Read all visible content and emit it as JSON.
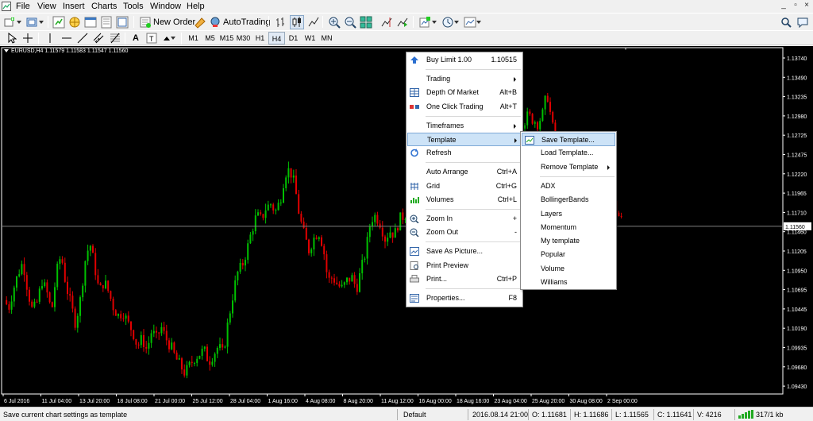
{
  "menu": [
    "File",
    "View",
    "Insert",
    "Charts",
    "Tools",
    "Window",
    "Help"
  ],
  "toolbar": {
    "new_order_label": "New Order",
    "autotrading_label": "AutoTrading",
    "timeframes": [
      "M1",
      "M5",
      "M15",
      "M30",
      "H1",
      "H4",
      "D1",
      "W1",
      "MN"
    ],
    "active_timeframe": "H4"
  },
  "chart": {
    "title": "EURUSD,H4  1.11579 1.11583 1.11547 1.11560",
    "current_price_label": "1.11560",
    "colors": {
      "background": "#000000",
      "bull": "#00c000",
      "bear": "#e00000",
      "axis_text": "#ffffff",
      "price_line": "#808080"
    }
  },
  "chart_data": {
    "type": "candlestick",
    "symbol": "EURUSD",
    "timeframe": "H4",
    "y_ticks": [
      "1.13740",
      "1.13490",
      "1.13235",
      "1.12980",
      "1.12725",
      "1.12475",
      "1.12220",
      "1.11965",
      "1.11710",
      "1.11460",
      "1.11205",
      "1.10950",
      "1.10695",
      "1.10445",
      "1.10190",
      "1.09935",
      "1.09680",
      "1.09430"
    ],
    "x_ticks": [
      "6 Jul 2016",
      "11 Jul 04:00",
      "13 Jul 20:00",
      "18 Jul 08:00",
      "21 Jul 00:00",
      "25 Jul 12:00",
      "28 Jul 04:00",
      "1 Aug 16:00",
      "4 Aug 08:00",
      "8 Aug 20:00",
      "11 Aug 12:00",
      "16 Aug 00:00",
      "18 Aug 16:00",
      "23 Aug 04:00",
      "25 Aug 20:00",
      "30 Aug 08:00",
      "2 Sep 00:00"
    ],
    "ylim": [
      1.0938,
      1.1384
    ],
    "current_price": 1.1156,
    "close_path": [
      [
        0,
        1.106
      ],
      [
        6,
        1.105
      ],
      [
        12,
        1.1075
      ],
      [
        18,
        1.1095
      ],
      [
        24,
        1.111
      ],
      [
        30,
        1.1072
      ],
      [
        36,
        1.1045
      ],
      [
        42,
        1.1058
      ],
      [
        48,
        1.1085
      ],
      [
        54,
        1.107
      ],
      [
        60,
        1.1045
      ],
      [
        66,
        1.1095
      ],
      [
        72,
        1.112
      ],
      [
        78,
        1.108
      ],
      [
        84,
        1.1055
      ],
      [
        90,
        1.103
      ],
      [
        96,
        1.106
      ],
      [
        102,
        1.111
      ],
      [
        108,
        1.1135
      ],
      [
        114,
        1.1105
      ],
      [
        120,
        1.107
      ],
      [
        126,
        1.1085
      ],
      [
        132,
        1.107
      ],
      [
        138,
        1.105
      ],
      [
        144,
        1.104
      ],
      [
        150,
        1.1045
      ],
      [
        156,
        1.103
      ],
      [
        162,
        1.102
      ],
      [
        168,
        1.1
      ],
      [
        174,
        1.101
      ],
      [
        180,
        1.0995
      ],
      [
        186,
        1.102
      ],
      [
        192,
        1.101
      ],
      [
        198,
        1.1025
      ],
      [
        204,
        1.101
      ],
      [
        210,
        1.1
      ],
      [
        216,
        1.0985
      ],
      [
        222,
        1.0975
      ],
      [
        228,
        1.0965
      ],
      [
        234,
        1.0975
      ],
      [
        240,
        1.0985
      ],
      [
        246,
        1.099
      ],
      [
        252,
        1.0995
      ],
      [
        258,
        1.098
      ],
      [
        264,
        1.099
      ],
      [
        270,
        1.1
      ],
      [
        276,
        1.099
      ],
      [
        282,
        1.103
      ],
      [
        288,
        1.1065
      ],
      [
        294,
        1.1095
      ],
      [
        300,
        1.1105
      ],
      [
        306,
        1.1125
      ],
      [
        312,
        1.115
      ],
      [
        318,
        1.117
      ],
      [
        324,
        1.1165
      ],
      [
        330,
        1.118
      ],
      [
        336,
        1.1185
      ],
      [
        342,
        1.1175
      ],
      [
        348,
        1.119
      ],
      [
        354,
        1.1225
      ],
      [
        360,
        1.123
      ],
      [
        366,
        1.121
      ],
      [
        372,
        1.117
      ],
      [
        378,
        1.1145
      ],
      [
        384,
        1.1125
      ],
      [
        390,
        1.114
      ],
      [
        396,
        1.115
      ],
      [
        402,
        1.113
      ],
      [
        408,
        1.1085
      ],
      [
        414,
        1.109
      ],
      [
        420,
        1.108
      ],
      [
        426,
        1.1075
      ],
      [
        432,
        1.1085
      ],
      [
        438,
        1.109
      ],
      [
        444,
        1.1075
      ],
      [
        450,
        1.11
      ],
      [
        456,
        1.1125
      ],
      [
        462,
        1.1165
      ],
      [
        468,
        1.117
      ],
      [
        474,
        1.116
      ],
      [
        480,
        1.114
      ],
      [
        486,
        1.115
      ],
      [
        492,
        1.1145
      ],
      [
        498,
        1.1165
      ],
      [
        504,
        1.117
      ],
      [
        510,
        1.1175
      ],
      [
        516,
        1.1185
      ],
      [
        522,
        1.1195
      ],
      [
        528,
        1.1215
      ],
      [
        534,
        1.1235
      ],
      [
        540,
        1.1255
      ],
      [
        546,
        1.127
      ],
      [
        552,
        1.128
      ],
      [
        558,
        1.1285
      ],
      [
        564,
        1.129
      ],
      [
        570,
        1.1285
      ],
      [
        576,
        1.129
      ],
      [
        582,
        1.1295
      ],
      [
        588,
        1.13
      ],
      [
        594,
        1.129
      ],
      [
        600,
        1.1285
      ],
      [
        606,
        1.1275
      ],
      [
        612,
        1.127
      ],
      [
        618,
        1.128
      ],
      [
        624,
        1.129
      ],
      [
        630,
        1.1285
      ],
      [
        636,
        1.128
      ],
      [
        642,
        1.129
      ],
      [
        648,
        1.1295
      ],
      [
        654,
        1.129
      ],
      [
        660,
        1.13
      ],
      [
        666,
        1.1295
      ],
      [
        672,
        1.129
      ],
      [
        678,
        1.13
      ],
      [
        684,
        1.133
      ],
      [
        690,
        1.129
      ],
      [
        696,
        1.126
      ],
      [
        702,
        1.124
      ],
      [
        708,
        1.123
      ],
      [
        714,
        1.122
      ],
      [
        720,
        1.12
      ],
      [
        726,
        1.119
      ],
      [
        732,
        1.1195
      ],
      [
        738,
        1.1185
      ],
      [
        744,
        1.118
      ],
      [
        750,
        1.1175
      ],
      [
        756,
        1.119
      ],
      [
        762,
        1.121
      ],
      [
        768,
        1.1185
      ],
      [
        774,
        1.117
      ],
      [
        780,
        1.116
      ],
      [
        786,
        1.1156
      ]
    ]
  },
  "context_menu": {
    "items": [
      {
        "label": "Buy Limit 1.00",
        "shortcut": "1.10515",
        "icon": "buy-limit-icon"
      },
      {
        "sep": true
      },
      {
        "label": "Trading",
        "submenu": true
      },
      {
        "label": "Depth Of Market",
        "shortcut": "Alt+B",
        "icon": "depth-of-market-icon"
      },
      {
        "label": "One Click Trading",
        "shortcut": "Alt+T",
        "icon": "one-click-trading-icon"
      },
      {
        "sep": true
      },
      {
        "label": "Timeframes",
        "submenu": true
      },
      {
        "label": "Template",
        "submenu": true,
        "highlighted": true
      },
      {
        "label": "Refresh",
        "icon": "refresh-icon"
      },
      {
        "sep": true
      },
      {
        "label": "Auto Arrange",
        "shortcut": "Ctrl+A"
      },
      {
        "label": "Grid",
        "shortcut": "Ctrl+G",
        "icon": "grid-icon"
      },
      {
        "label": "Volumes",
        "shortcut": "Ctrl+L",
        "icon": "volumes-icon"
      },
      {
        "sep": true
      },
      {
        "label": "Zoom In",
        "shortcut": "+",
        "icon": "zoom-in-icon"
      },
      {
        "label": "Zoom Out",
        "shortcut": "-",
        "icon": "zoom-out-icon"
      },
      {
        "sep": true
      },
      {
        "label": "Save As Picture...",
        "icon": "save-picture-icon"
      },
      {
        "label": "Print Preview",
        "icon": "print-preview-icon"
      },
      {
        "label": "Print...",
        "shortcut": "Ctrl+P",
        "icon": "print-icon"
      },
      {
        "sep": true
      },
      {
        "label": "Properties...",
        "shortcut": "F8",
        "icon": "properties-icon"
      }
    ]
  },
  "template_submenu": {
    "items": [
      {
        "label": "Save Template...",
        "highlighted": true,
        "icon": "save-template-icon"
      },
      {
        "label": "Load Template..."
      },
      {
        "label": "Remove Template",
        "submenu": true
      },
      {
        "sep": true
      },
      {
        "label": "ADX"
      },
      {
        "label": "BollingerBands"
      },
      {
        "label": "Layers"
      },
      {
        "label": "Momentum"
      },
      {
        "label": "My template"
      },
      {
        "label": "Popular"
      },
      {
        "label": "Volume"
      },
      {
        "label": "Williams"
      }
    ]
  },
  "status": {
    "message": "Save current chart settings as template",
    "profile": "Default",
    "datetime": "2016.08.14 21:00",
    "open": "O: 1.11681",
    "high": "H: 1.11686",
    "low": "L: 1.11565",
    "close": "C: 1.11641",
    "volume": "V: 4216",
    "traffic": "317/1 kb"
  }
}
